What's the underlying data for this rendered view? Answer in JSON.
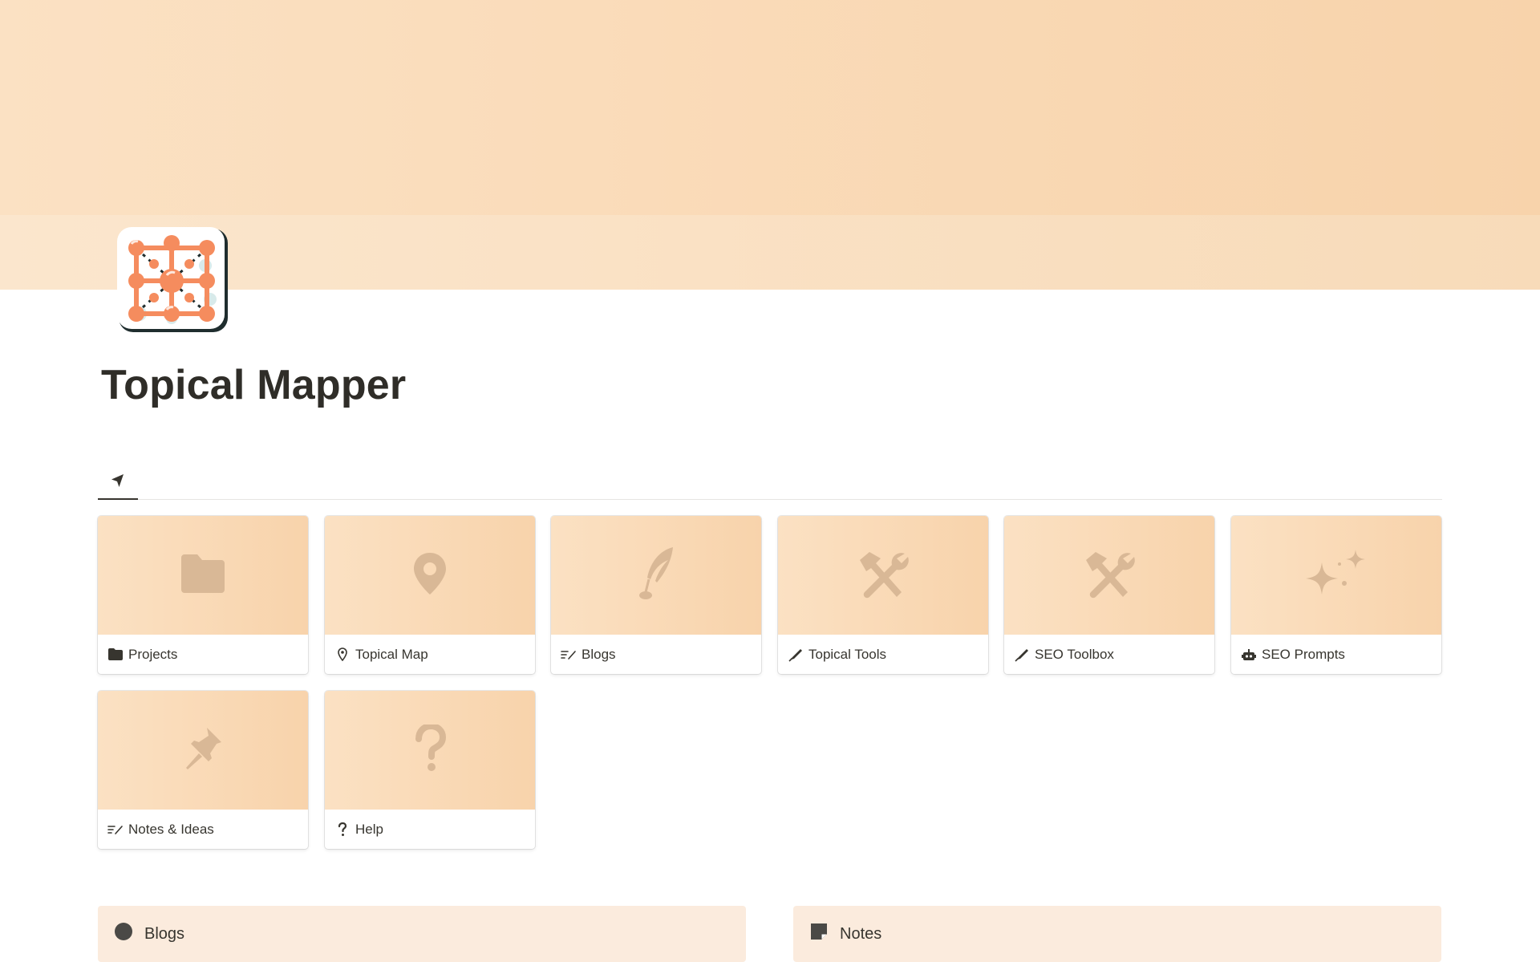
{
  "page": {
    "title": "Topical Mapper"
  },
  "tabs": [
    {
      "icon": "navigation-arrow-icon"
    }
  ],
  "gallery": {
    "cards": [
      {
        "label": "Projects",
        "cover_icon": "folder-icon",
        "label_icon": "folder-icon"
      },
      {
        "label": "Topical Map",
        "cover_icon": "map-pin-icon",
        "label_icon": "map-pin-icon"
      },
      {
        "label": "Blogs",
        "cover_icon": "quill-icon",
        "label_icon": "text-edit-icon"
      },
      {
        "label": "Topical Tools",
        "cover_icon": "hammer-wrench-icon",
        "label_icon": "pen-nib-icon"
      },
      {
        "label": "SEO Toolbox",
        "cover_icon": "hammer-wrench-icon",
        "label_icon": "pen-nib-icon"
      },
      {
        "label": "SEO Prompts",
        "cover_icon": "sparkles-icon",
        "label_icon": "robot-icon"
      },
      {
        "label": "Notes & Ideas",
        "cover_icon": "pushpin-icon",
        "label_icon": "text-edit-icon"
      },
      {
        "label": "Help",
        "cover_icon": "question-mark-icon",
        "label_icon": "question-mark-icon"
      }
    ]
  },
  "callouts": [
    {
      "label": "Blogs",
      "icon": "circle-icon"
    },
    {
      "label": "Notes",
      "icon": "sticky-note-icon"
    }
  ],
  "colors": {
    "cover_start": "#fbe1c3",
    "cover_end": "#f8d3ab",
    "icon_accent": "#f58c5e",
    "callout_bg": "#fbebdd",
    "muted_icon": "#d9b896"
  }
}
